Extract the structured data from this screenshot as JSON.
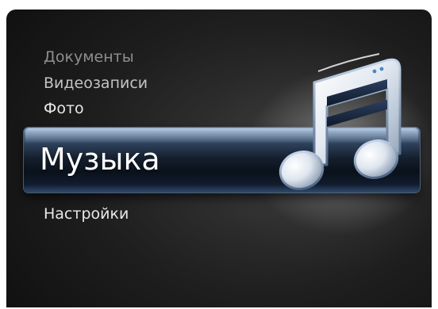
{
  "menu": {
    "items": [
      {
        "label": "Документы"
      },
      {
        "label": "Видеозаписи"
      },
      {
        "label": "Фото"
      },
      {
        "label": "Музыка",
        "selected": true
      },
      {
        "label": "Настройки"
      }
    ]
  },
  "icons": {
    "selected": "music-note-icon"
  },
  "colors": {
    "background": "#1a1a1a",
    "selection_bar": "#1b2b42",
    "selection_border": "#7896be",
    "icon_body": "#e6ecf4"
  }
}
